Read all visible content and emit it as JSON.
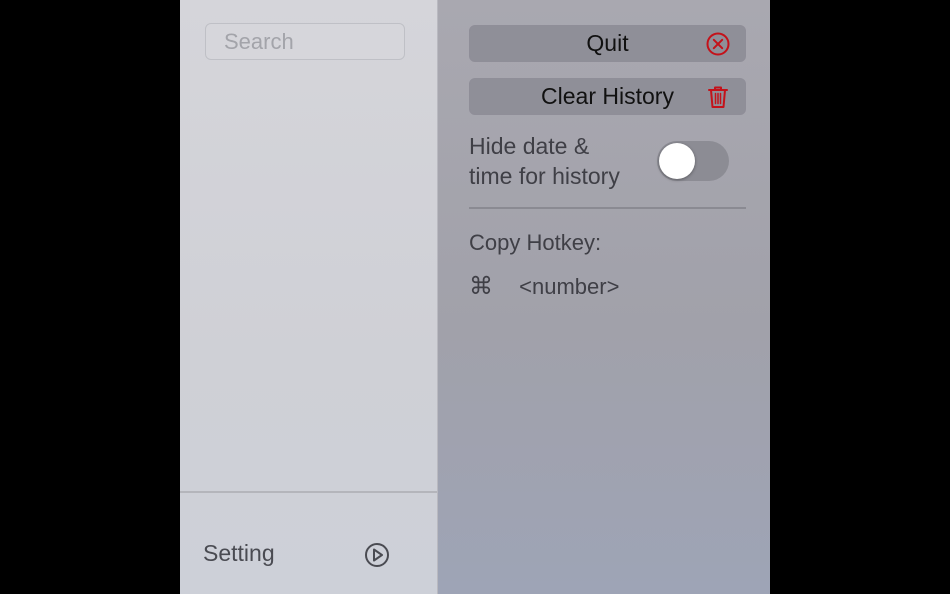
{
  "search": {
    "placeholder": "Search"
  },
  "footer": {
    "setting_label": "Setting",
    "setting_icon": "settings-play-icon"
  },
  "actions": {
    "quit_label": "Quit",
    "quit_icon": "close-circle-icon",
    "clear_history_label": "Clear History",
    "clear_history_icon": "trash-icon",
    "accent_red": "#c4121a"
  },
  "toggle": {
    "label_line1": "Hide date &",
    "label_line2": "time for history",
    "checked": false
  },
  "hotkey": {
    "title": "Copy Hotkey:",
    "modifier_symbol": "⌘",
    "value": "<number>"
  }
}
